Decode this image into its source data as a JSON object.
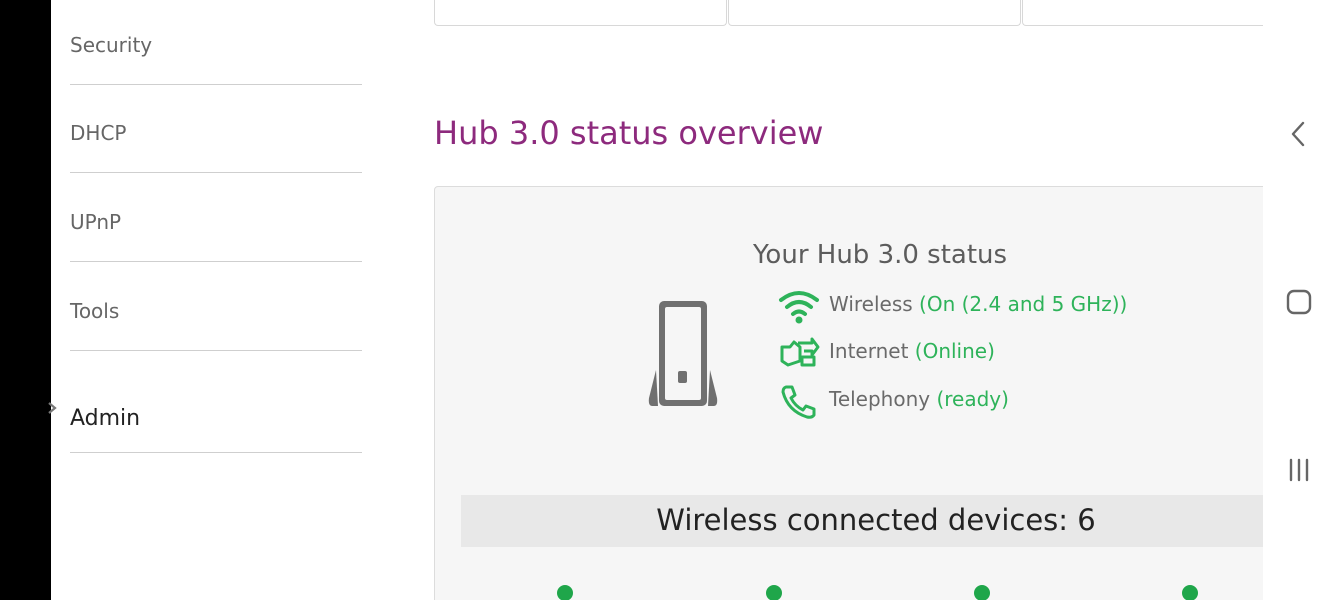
{
  "sidebar": {
    "items": [
      {
        "label": "Security"
      },
      {
        "label": "DHCP"
      },
      {
        "label": "UPnP"
      },
      {
        "label": "Tools"
      },
      {
        "label": "Admin"
      }
    ]
  },
  "overview": {
    "title": "Hub 3.0 status overview",
    "status_heading": "Your Hub 3.0 status",
    "rows": [
      {
        "label": "Wireless",
        "value": "(On (2.4 and 5 GHz))",
        "icon": "wifi-icon"
      },
      {
        "label": "Internet",
        "value": "(Online)",
        "icon": "internet-icon"
      },
      {
        "label": "Telephony",
        "value": "(ready)",
        "icon": "phone-icon"
      }
    ],
    "wireless_devices": "Wireless connected devices: 6"
  },
  "colors": {
    "accent": "#8d2a7d",
    "status_green": "#2eb35a",
    "text_gray": "#6a6a6a"
  },
  "system_nav": {
    "back_icon": "back-chevron-icon",
    "home_icon": "home-square-icon",
    "recents_icon": "recents-icon"
  }
}
